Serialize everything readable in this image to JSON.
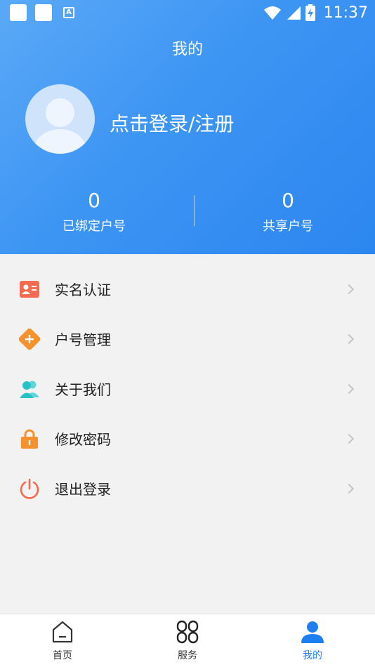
{
  "status_bar": {
    "time": "11:37"
  },
  "header": {
    "title": "我的"
  },
  "profile": {
    "login_text": "点击登录/注册"
  },
  "stats": [
    {
      "value": "0",
      "label": "已绑定户号"
    },
    {
      "value": "0",
      "label": "共享户号"
    }
  ],
  "menu": [
    {
      "label": "实名认证",
      "icon": "id-card-icon",
      "color": "#f56b52"
    },
    {
      "label": "户号管理",
      "icon": "plus-diamond-icon",
      "color": "#f5922e"
    },
    {
      "label": "关于我们",
      "icon": "users-icon",
      "color": "#27c2c8"
    },
    {
      "label": "修改密码",
      "icon": "lock-icon",
      "color": "#f5922e"
    },
    {
      "label": "退出登录",
      "icon": "power-icon",
      "color": "#f56b52"
    }
  ],
  "tabs": [
    {
      "label": "首页",
      "icon": "home-icon",
      "active": false
    },
    {
      "label": "服务",
      "icon": "grid-icon",
      "active": false
    },
    {
      "label": "我的",
      "icon": "person-icon",
      "active": true
    }
  ],
  "colors": {
    "accent": "#1e7ef0",
    "header_start": "#5aa9f7",
    "header_end": "#2b86ef"
  }
}
